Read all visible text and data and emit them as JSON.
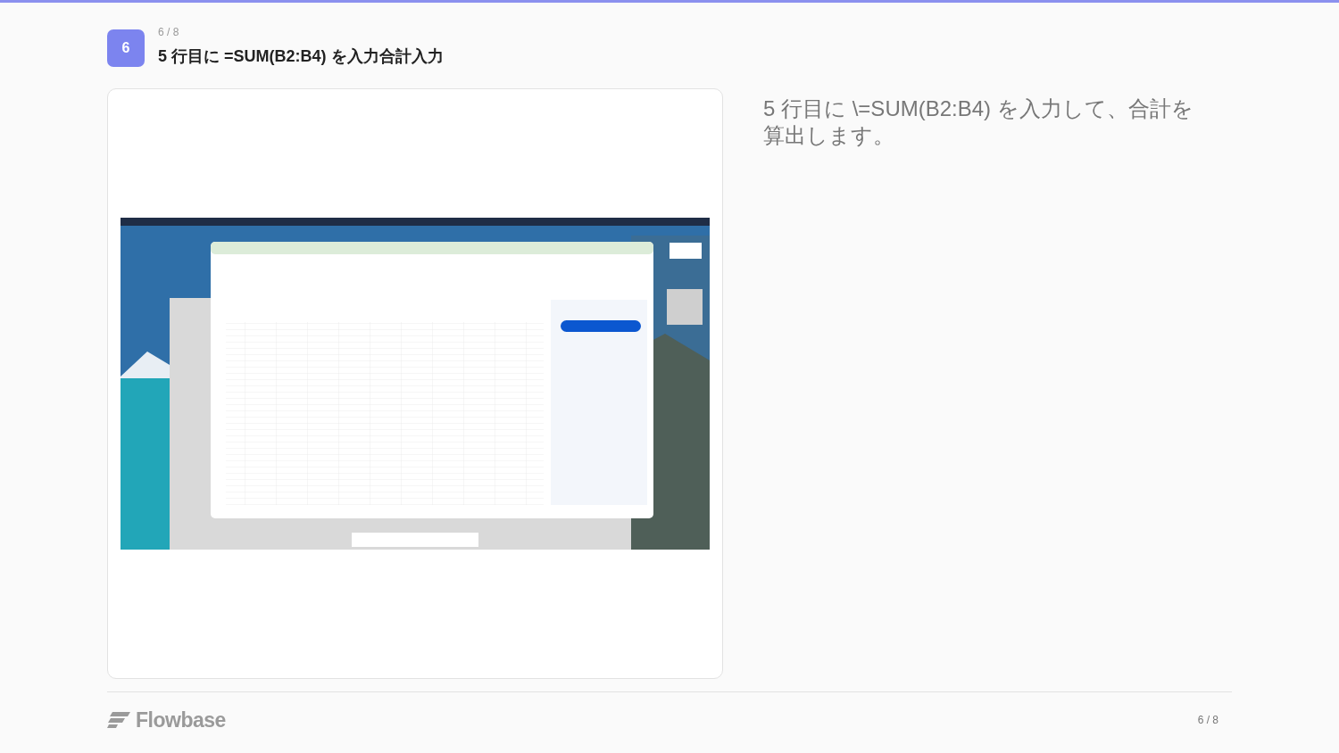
{
  "step": {
    "number": "6",
    "count": "6 / 8",
    "title": "5 行目に =SUM(B2:B4) を入力合計入力"
  },
  "description": "5 行目に \\=SUM(B2:B4) を入力して、合計を算出します。",
  "footer": {
    "brand": "Flowbase",
    "page": "6 / 8"
  }
}
